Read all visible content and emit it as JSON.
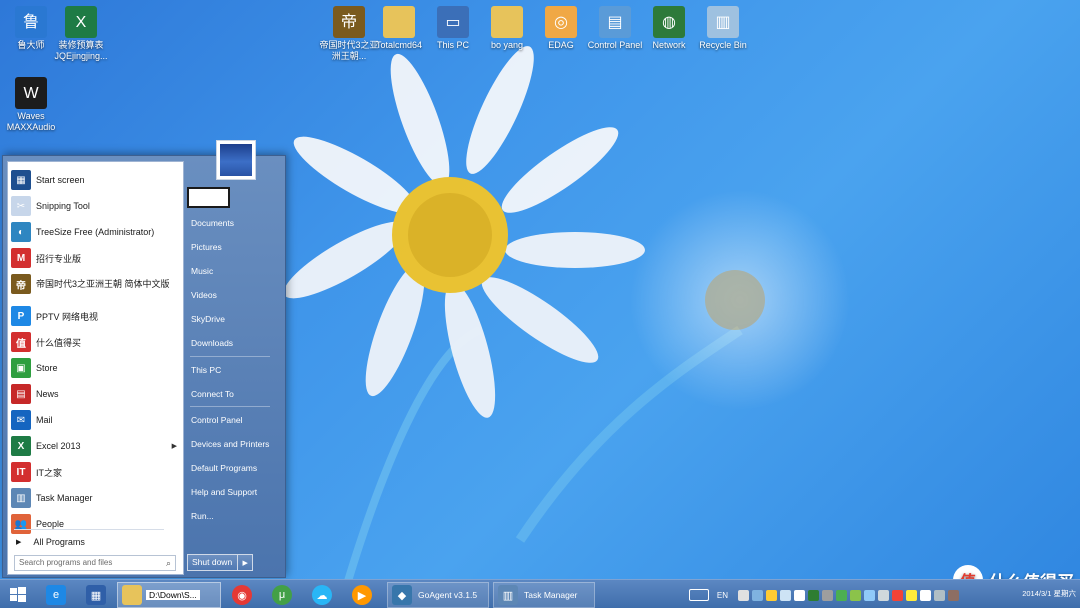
{
  "desktop": {
    "icons": [
      {
        "label": "鲁大师",
        "icon": "ludashi-icon",
        "color": "#2a78d2",
        "glyph": "鲁"
      },
      {
        "label": "装修预算表 JQEjingjing...",
        "icon": "excel-file-icon",
        "color": "#1e7b45",
        "glyph": "X"
      },
      {
        "label": "Waves MAXXAudio",
        "icon": "waves-audio-icon",
        "color": "#1c1c1c",
        "glyph": "W"
      },
      {
        "label": "帝国时代3之亚洲王朝...",
        "icon": "age-of-empires-icon",
        "color": "#7a5a1e",
        "glyph": "帝"
      },
      {
        "label": "Totalcmd64",
        "icon": "folder-icon",
        "color": "#e7c35b",
        "glyph": ""
      },
      {
        "label": "This PC",
        "icon": "computer-icon",
        "color": "#3b6fb8",
        "glyph": "▭"
      },
      {
        "label": "bo yang",
        "icon": "user-folder-icon",
        "color": "#e7c35b",
        "glyph": ""
      },
      {
        "label": "EDAG",
        "icon": "edag-folder-icon",
        "color": "#f0a845",
        "glyph": "◎"
      },
      {
        "label": "Control Panel",
        "icon": "control-panel-icon",
        "color": "#5a9bd8",
        "glyph": "▤"
      },
      {
        "label": "Network",
        "icon": "network-icon",
        "color": "#2d7a3a",
        "glyph": "◍"
      },
      {
        "label": "Recycle Bin",
        "icon": "recycle-bin-icon",
        "color": "#9ec1e0",
        "glyph": "▥"
      }
    ]
  },
  "start_menu": {
    "programs": [
      {
        "label": "Start screen",
        "icon": "start-screen-icon",
        "color": "#1e4f8f",
        "glyph": "▦"
      },
      {
        "label": "Snipping Tool",
        "icon": "scissors-icon",
        "color": "#c7d6ea",
        "glyph": "✂"
      },
      {
        "label": "TreeSize Free (Administrator)",
        "icon": "treesize-icon",
        "color": "#2e86c1",
        "glyph": "◐"
      },
      {
        "label": "招行专业版",
        "icon": "cmb-icon",
        "color": "#d32f2f",
        "glyph": "M"
      },
      {
        "label": "帝国时代3之亚洲王朝 简体中文版",
        "icon": "age-of-empires-icon",
        "color": "#7a5a1e",
        "glyph": "帝"
      },
      {
        "label": "PPTV 网络电视",
        "icon": "pptv-icon",
        "color": "#1e88e5",
        "glyph": "P"
      },
      {
        "label": "什么值得买",
        "icon": "smzdm-icon",
        "color": "#d32f2f",
        "glyph": "值"
      },
      {
        "label": "Store",
        "icon": "store-icon",
        "color": "#2e9e3f",
        "glyph": "▣"
      },
      {
        "label": "News",
        "icon": "news-icon",
        "color": "#c62828",
        "glyph": "▤"
      },
      {
        "label": "Mail",
        "icon": "mail-icon",
        "color": "#1565c0",
        "glyph": "✉"
      },
      {
        "label": "Excel 2013",
        "icon": "excel-icon",
        "color": "#1e7b45",
        "glyph": "X",
        "submenu": true
      },
      {
        "label": "IT之家",
        "icon": "ithome-icon",
        "color": "#d32f2f",
        "glyph": "IT"
      },
      {
        "label": "Task Manager",
        "icon": "task-manager-icon",
        "color": "#5d87b5",
        "glyph": "▥"
      },
      {
        "label": "People",
        "icon": "people-icon",
        "color": "#e0633a",
        "glyph": "👥"
      }
    ],
    "all_programs": "All Programs",
    "search_placeholder": "Search programs and files",
    "right_items": [
      {
        "label": "Documents",
        "group": 1
      },
      {
        "label": "Pictures",
        "group": 1
      },
      {
        "label": "Music",
        "group": 1
      },
      {
        "label": "Videos",
        "group": 1
      },
      {
        "label": "SkyDrive",
        "group": 1
      },
      {
        "label": "Downloads",
        "group": 1
      },
      {
        "label": "This PC",
        "group": 2
      },
      {
        "label": "Connect To",
        "group": 2
      },
      {
        "label": "Control Panel",
        "group": 3
      },
      {
        "label": "Devices and Printers",
        "group": 3
      },
      {
        "label": "Default Programs",
        "group": 3
      },
      {
        "label": "Help and Support",
        "group": 3
      },
      {
        "label": "Run...",
        "group": 3
      }
    ],
    "shutdown_label": "Shut down"
  },
  "taskbar": {
    "start_icon": "windows-logo-icon",
    "pinned": [
      {
        "name": "internet-explorer-icon",
        "color": "#1e88e5",
        "glyph": "e"
      },
      {
        "name": "metro-app-icon",
        "color": "#2f5fa8",
        "glyph": "▦"
      }
    ],
    "explorer_label": "D:\\Down\\S...",
    "apps": [
      {
        "name": "chrome-icon",
        "color": "#e53935",
        "glyph": "◉"
      },
      {
        "name": "utorrent-icon",
        "color": "#43a047",
        "glyph": "μ"
      },
      {
        "name": "baidu-yun-icon",
        "color": "#29b6f6",
        "glyph": "☁"
      },
      {
        "name": "media-player-icon",
        "color": "#ff9800",
        "glyph": "▶"
      }
    ],
    "goagent_label": "GoAgent v3.1.5",
    "taskmanager_label": "Task Manager",
    "tray_lang": "EN",
    "tray_colors": [
      "#e0e0e0",
      "#7fb3e0",
      "#ffcc33",
      "#cde3f5",
      "#ffffff",
      "#2e7d32",
      "#9e9e9e",
      "#4caf50",
      "#8bc34a",
      "#90caf9",
      "#cfd8dc",
      "#f44336",
      "#ffeb3b",
      "#ffffff",
      "#b0bec5",
      "#8d6e63"
    ],
    "clock_date": "2014/3/1 星期六"
  },
  "watermark": {
    "text": "什么值得买"
  }
}
